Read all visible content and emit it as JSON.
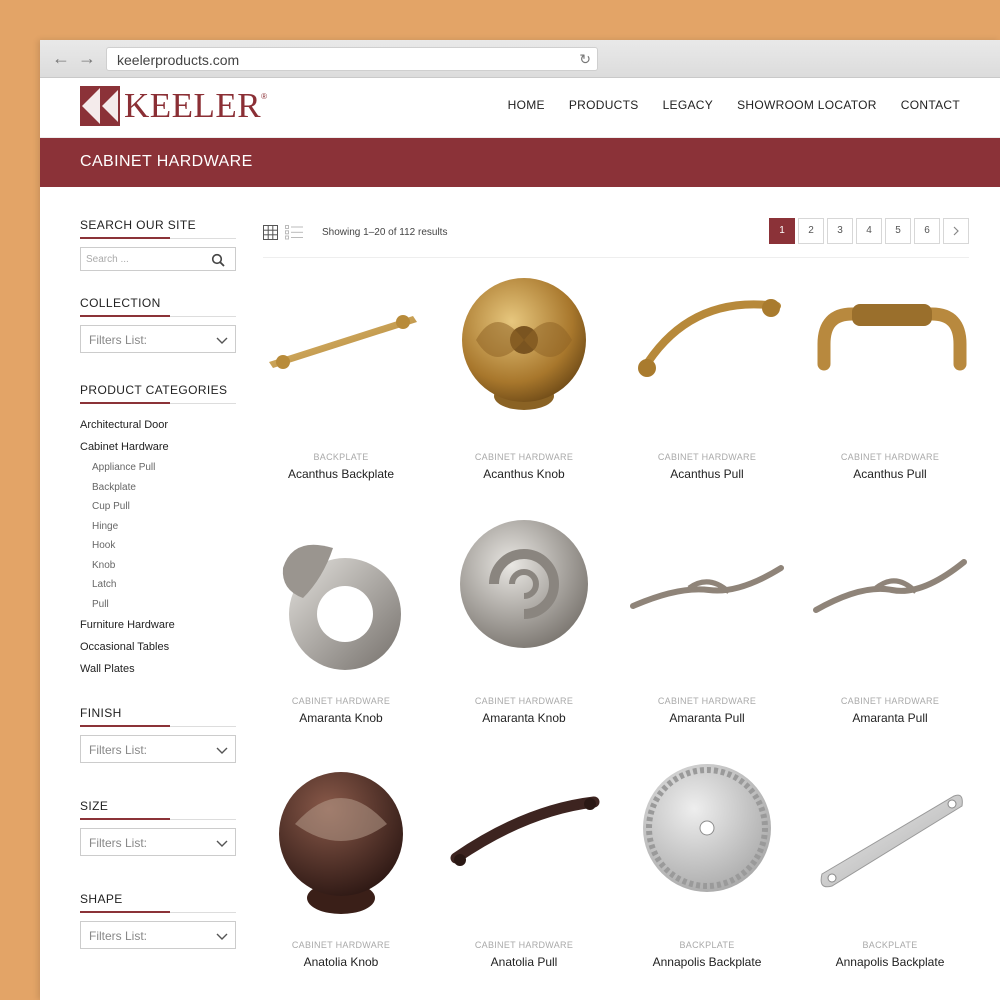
{
  "browser": {
    "url": "keelerproducts.com"
  },
  "brand": {
    "name": "KEELER",
    "registered": "®",
    "color": "#8b3238"
  },
  "nav": [
    "HOME",
    "PRODUCTS",
    "LEGACY",
    "SHOWROOM LOCATOR",
    "CONTACT"
  ],
  "banner": {
    "title": "CABINET HARDWARE"
  },
  "sidebar": {
    "search_title": "SEARCH OUR SITE",
    "search_placeholder": "Search ...",
    "collection_title": "COLLECTION",
    "categories_title": "PRODUCT CATEGORIES",
    "categories": [
      "Architectural Door",
      "Cabinet Hardware",
      "Appliance Pull",
      "Backplate",
      "Cup Pull",
      "Hinge",
      "Hook",
      "Knob",
      "Latch",
      "Pull",
      "Furniture Hardware",
      "Occasional Tables",
      "Wall Plates"
    ],
    "finish_title": "FINISH",
    "size_title": "SIZE",
    "shape_title": "SHAPE",
    "filter_placeholder": "Filters List:"
  },
  "toolbar": {
    "result_count": "Showing 1–20 of 112 results"
  },
  "pagination": {
    "pages": [
      "1",
      "2",
      "3",
      "4",
      "5",
      "6"
    ],
    "current": "1",
    "next_icon": "chevron-right-icon"
  },
  "products": [
    {
      "category": "BACKPLATE",
      "name": "Acanthus Backplate"
    },
    {
      "category": "CABINET HARDWARE",
      "name": "Acanthus Knob"
    },
    {
      "category": "CABINET HARDWARE",
      "name": "Acanthus Pull"
    },
    {
      "category": "CABINET HARDWARE",
      "name": "Acanthus Pull"
    },
    {
      "category": "CABINET HARDWARE",
      "name": "Amaranta Knob"
    },
    {
      "category": "CABINET HARDWARE",
      "name": "Amaranta Knob"
    },
    {
      "category": "CABINET HARDWARE",
      "name": "Amaranta Pull"
    },
    {
      "category": "CABINET HARDWARE",
      "name": "Amaranta Pull"
    },
    {
      "category": "CABINET HARDWARE",
      "name": "Anatolia Knob"
    },
    {
      "category": "CABINET HARDWARE",
      "name": "Anatolia Pull"
    },
    {
      "category": "BACKPLATE",
      "name": "Annapolis Backplate"
    },
    {
      "category": "BACKPLATE",
      "name": "Annapolis Backplate"
    }
  ]
}
